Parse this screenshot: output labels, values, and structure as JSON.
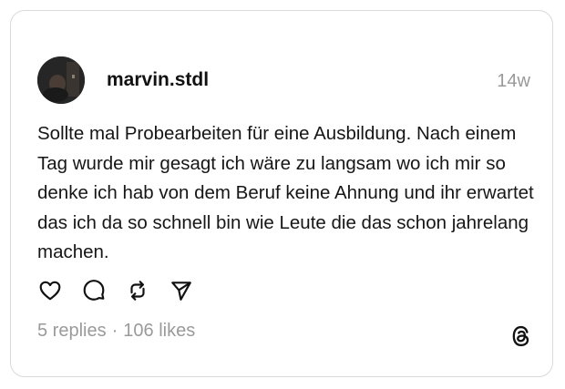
{
  "post": {
    "username": "marvin.stdl",
    "timestamp": "14w",
    "text": "Sollte mal Probearbeiten für eine Ausbildung. Nach einem Tag wurde mir gesagt ich wäre zu langsam wo ich mir so denke ich hab von dem Beruf keine Ahnung und ihr erwartet das ich da so schnell bin wie Leute die das schon jahrelang machen.",
    "replies_label": "5 replies",
    "separator": "·",
    "likes_label": "106 likes"
  },
  "icons": {
    "like": "heart-icon",
    "reply": "speech-bubble-icon",
    "repost": "repost-icon",
    "share": "paper-plane-icon",
    "brand": "threads-logo-icon"
  },
  "colors": {
    "text": "#161616",
    "muted": "#999999",
    "border": "#d9d9d9",
    "background": "#ffffff"
  }
}
